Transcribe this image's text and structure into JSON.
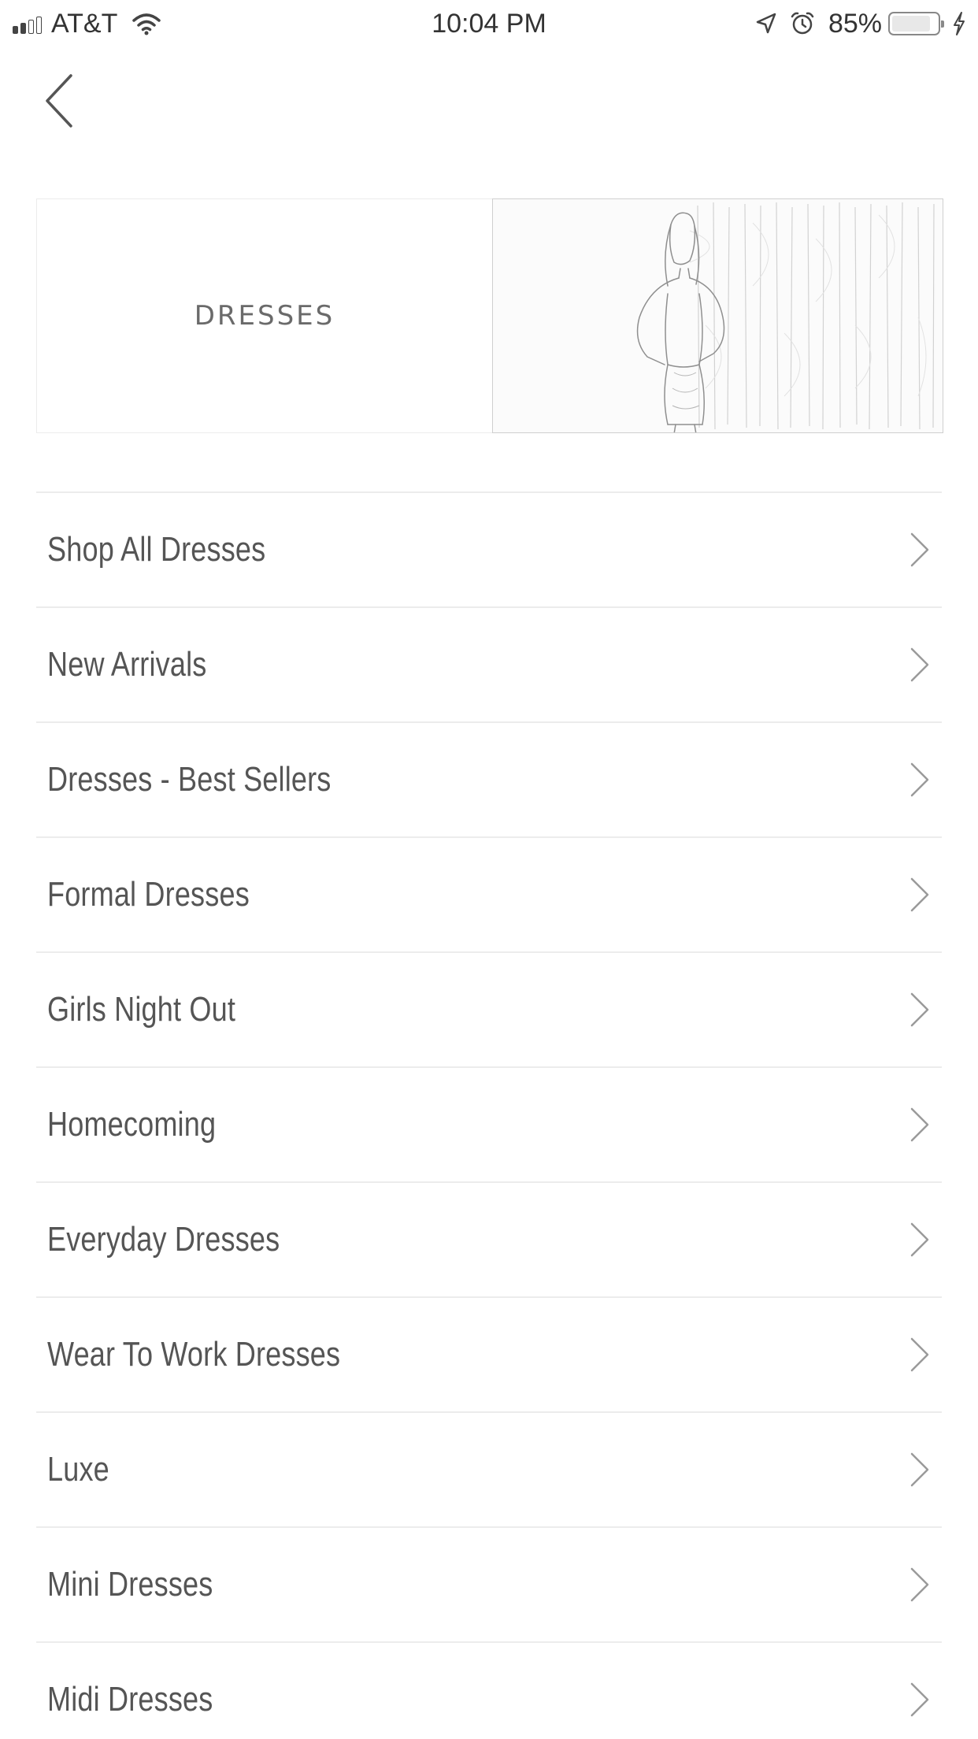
{
  "status_bar": {
    "carrier": "AT&T",
    "time": "10:04 PM",
    "battery_percent": "85%",
    "battery_level": 0.85,
    "icons": [
      "signal-icon",
      "wifi-icon",
      "location-icon",
      "alarm-icon",
      "battery-icon",
      "charging-icon"
    ]
  },
  "nav": {
    "back_icon": "chevron-left-icon"
  },
  "banner": {
    "title": "DRESSES",
    "image": "model-in-dress-photo"
  },
  "menu": {
    "items": [
      {
        "label": "Shop All Dresses"
      },
      {
        "label": "New Arrivals"
      },
      {
        "label": "Dresses - Best Sellers"
      },
      {
        "label": "Formal Dresses"
      },
      {
        "label": "Girls Night Out"
      },
      {
        "label": "Homecoming"
      },
      {
        "label": "Everyday Dresses"
      },
      {
        "label": "Wear To Work Dresses"
      },
      {
        "label": "Luxe"
      },
      {
        "label": "Mini Dresses"
      },
      {
        "label": "Midi Dresses"
      }
    ],
    "item_icon": "chevron-right-icon"
  },
  "colors": {
    "text": "#555555",
    "divider": "#ececec",
    "background": "#ffffff"
  }
}
